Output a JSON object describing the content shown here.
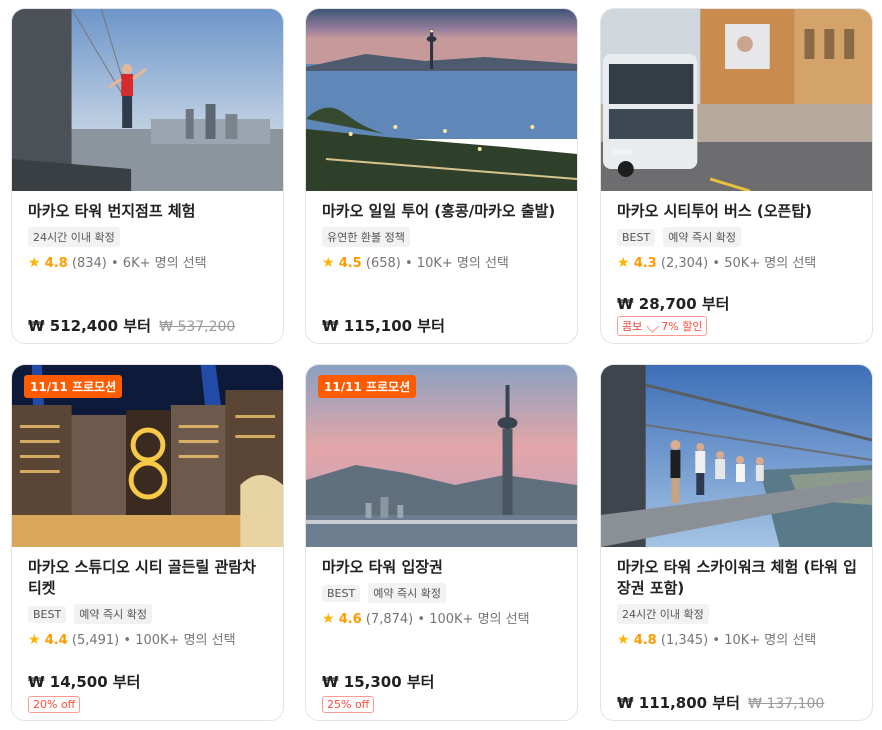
{
  "cards": [
    {
      "title": "마카오 타워 번지점프 체험",
      "tags": [
        "24시간 이내 확정"
      ],
      "score": "4.8",
      "reviews": "(834)",
      "chosen": "6K+ 명의 선택",
      "price": "₩ 512,400 부터",
      "old_price": "₩ 537,200"
    },
    {
      "title": "마카오 일일 투어 (홍콩/마카오 출발)",
      "tags": [
        "유연한 환불 정책"
      ],
      "score": "4.5",
      "reviews": "(658)",
      "chosen": "10K+ 명의 선택",
      "price": "₩ 115,100 부터"
    },
    {
      "title": "마카오 시티투어 버스 (오픈탑)",
      "tags": [
        "BEST",
        "예약 즉시 확정"
      ],
      "score": "4.3",
      "reviews": "(2,304)",
      "chosen": "50K+ 명의 선택",
      "price": "₩ 28,700 부터",
      "badge_combo": "콤보",
      "badge_text": "7% 할인"
    },
    {
      "promo": "11/11 프로모션",
      "title": "마카오 스튜디오 시티 골든릴 관람차 티켓",
      "tags": [
        "BEST",
        "예약 즉시 확정"
      ],
      "score": "4.4",
      "reviews": "(5,491)",
      "chosen": "100K+ 명의 선택",
      "price": "₩ 14,500 부터",
      "badge_text": "20% off"
    },
    {
      "promo": "11/11 프로모션",
      "title": "마카오 타워 입장권",
      "tags": [
        "BEST",
        "예약 즉시 확정"
      ],
      "score": "4.6",
      "reviews": "(7,874)",
      "chosen": "100K+ 명의 선택",
      "price": "₩ 15,300 부터",
      "badge_text": "25% off"
    },
    {
      "title": "마카오 타워 스카이워크 체험 (타워 입장권 포함)",
      "tags": [
        "24시간 이내 확정"
      ],
      "score": "4.8",
      "reviews": "(1,345)",
      "chosen": "10K+ 명의 선택",
      "price": "₩ 111,800 부터",
      "old_price": "₩ 137,100"
    }
  ],
  "sep": "•",
  "star_glyph": "★"
}
